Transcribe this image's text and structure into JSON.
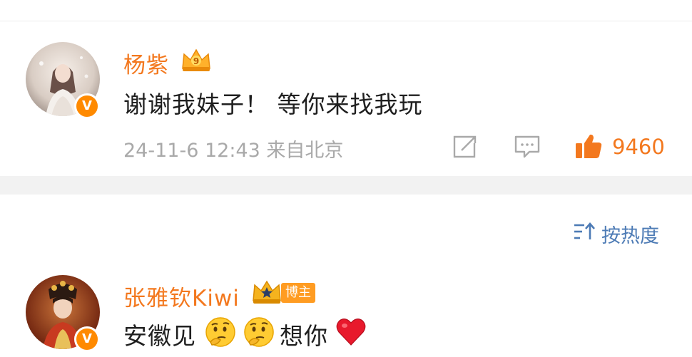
{
  "comments": [
    {
      "username": "杨紫",
      "badge_icon": "crown-level-9-icon",
      "verified_badge": "V",
      "text": "谢谢我妹子！ 等你来找我玩",
      "meta": "24-11-6 12:43 来自北京",
      "like_count": "9460"
    },
    {
      "username": "张雅钦Kiwi",
      "badge_icon": "crown-star-icon",
      "tag": "博主",
      "verified_badge": "V",
      "text_before": "安徽见",
      "text_after": "想你",
      "emojis": [
        "thinking-face-icon",
        "thinking-face-icon",
        "red-heart-icon"
      ]
    }
  ],
  "sort": {
    "label": "按热度"
  },
  "colors": {
    "accent_orange": "#f3781e",
    "link_blue": "#4d7bb5",
    "meta_gray": "#a9a9a9"
  }
}
